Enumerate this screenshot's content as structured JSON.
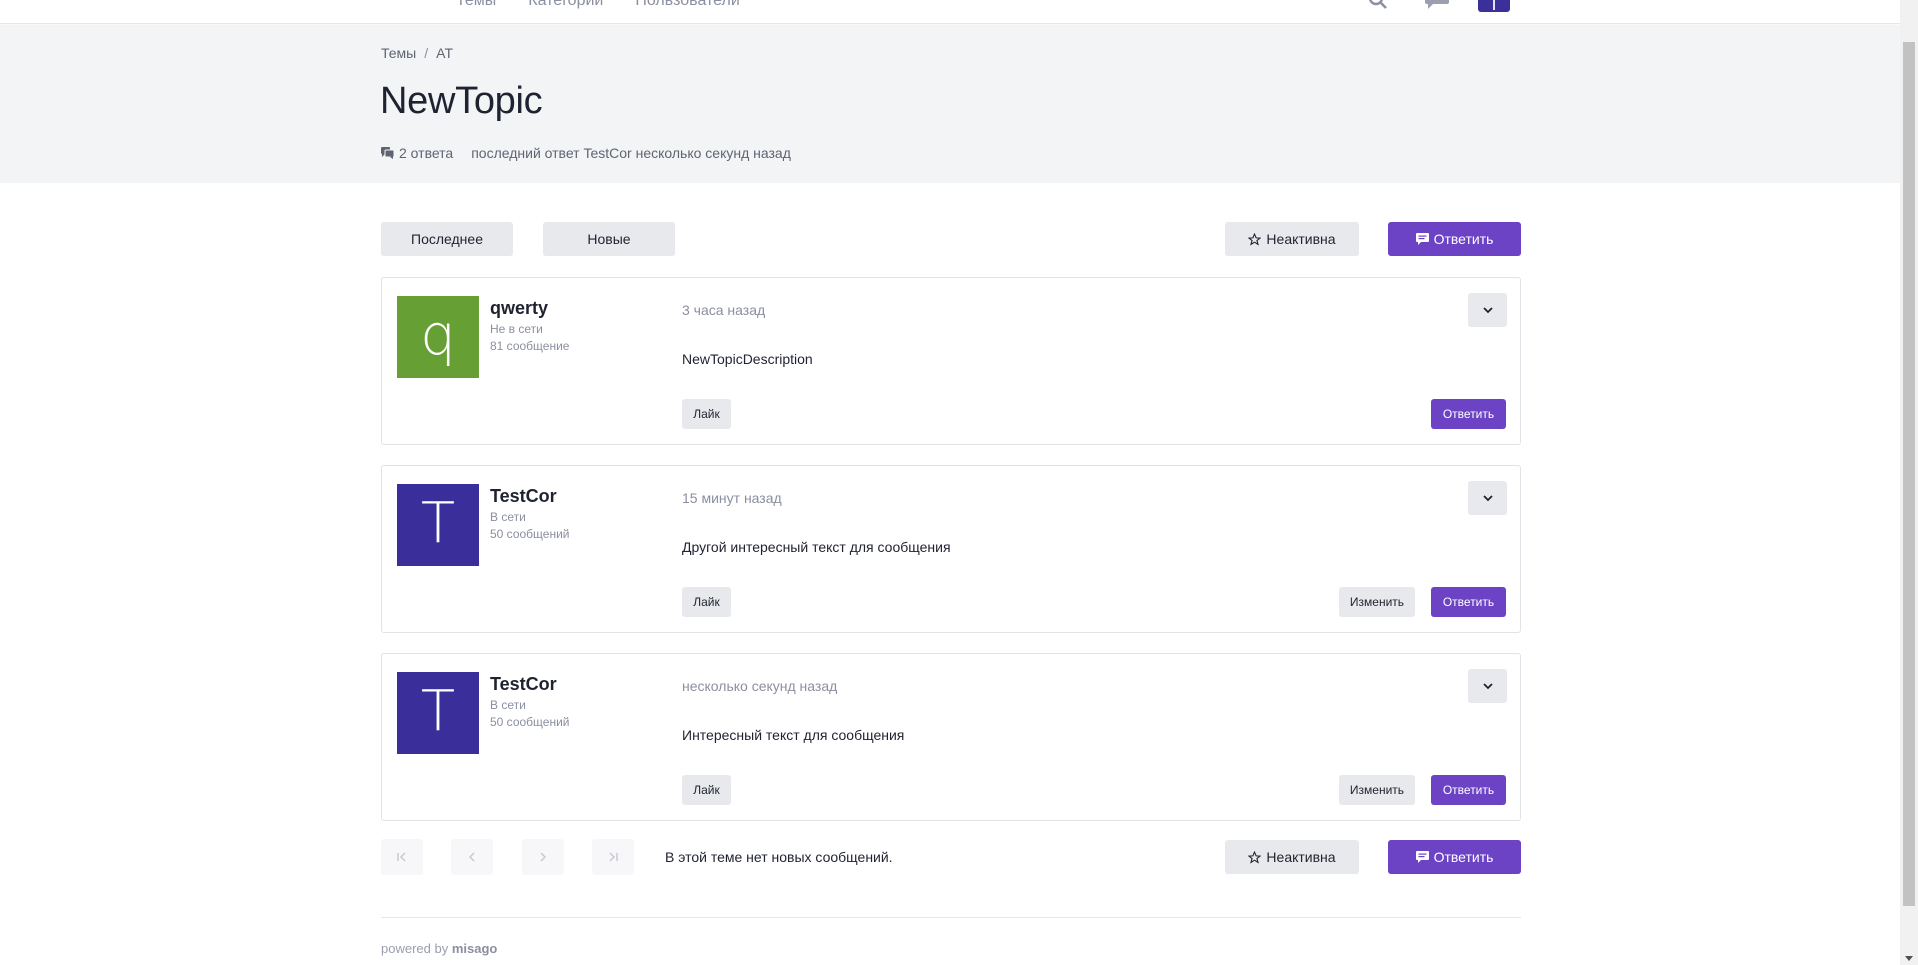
{
  "navbar": {
    "links": [
      "Темы",
      "Категории",
      "Пользователи"
    ],
    "avatar_letter": "T"
  },
  "breadcrumb": {
    "items": [
      "Темы",
      "AT"
    ],
    "separator": "/"
  },
  "topic": {
    "title": "NewTopic",
    "replies": "2 ответа",
    "last_reply": "последний ответ TestCor несколько секунд назад"
  },
  "toolbar": {
    "latest_label": "Последнее",
    "new_label": "Новые",
    "subscription_label": "Неактивна",
    "reply_label": "Ответить"
  },
  "posts": [
    {
      "avatar_letter": "q",
      "avatar_color": "#66a034",
      "username": "qwerty",
      "status": "Не в сети",
      "count": "81 сообщение",
      "time": "3 часа назад",
      "body": "NewTopicDescription",
      "like_label": "Лайк",
      "reply_label": "Ответить"
    },
    {
      "avatar_letter": "T",
      "avatar_color": "#3a2f9a",
      "username": "TestCor",
      "status": "В сети",
      "count": "50 сообщений",
      "time": "15 минут назад",
      "body": "Другой интересный текст для сообщения",
      "like_label": "Лайк",
      "edit_label": "Изменить",
      "reply_label": "Ответить"
    },
    {
      "avatar_letter": "T",
      "avatar_color": "#3a2f9a",
      "username": "TestCor",
      "status": "В сети",
      "count": "50 сообщений",
      "time": "несколько секунд назад",
      "body": "Интересный текст для сообщения",
      "like_label": "Лайк",
      "edit_label": "Изменить",
      "reply_label": "Ответить"
    }
  ],
  "bottom": {
    "no_new_message": "В этой теме нет новых сообщений.",
    "subscription_label": "Неактивна",
    "reply_label": "Ответить"
  },
  "footer": {
    "powered_by": "powered by",
    "brand": "misago"
  },
  "colors": {
    "primary": "#6c43c5",
    "header_bg": "#f3f4f6",
    "button_default": "#e8e9ed"
  }
}
